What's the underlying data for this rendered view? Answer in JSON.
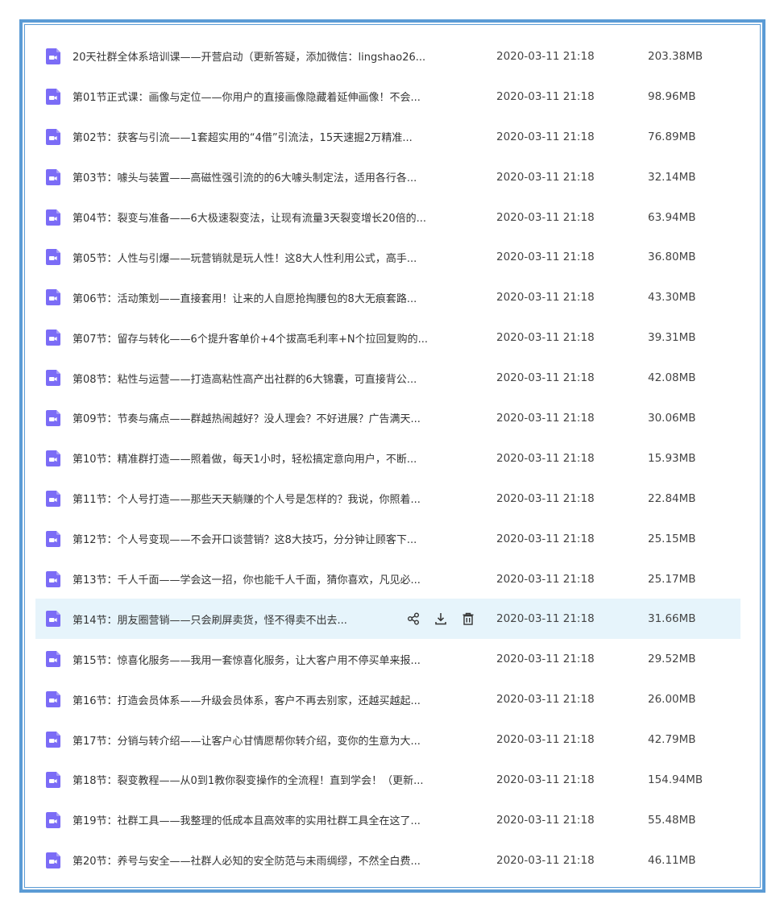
{
  "colors": {
    "accent": "#5b9bd5",
    "icon": "#7b6cf6",
    "hover_bg": "#e6f4fb"
  },
  "files": [
    {
      "name": "20天社群全体系培训课——开营启动（更新答疑，添加微信：lingshao26...",
      "date": "2020-03-11 21:18",
      "size": "203.38MB",
      "icon": "video-file-icon"
    },
    {
      "name": "第01节正式课：画像与定位——你用户的直接画像隐藏着延伸画像！不会...",
      "date": "2020-03-11 21:18",
      "size": "98.96MB",
      "icon": "video-file-icon"
    },
    {
      "name": "第02节：获客与引流——1套超实用的“4借”引流法，15天速掘2万精准...",
      "date": "2020-03-11 21:18",
      "size": "76.89MB",
      "icon": "video-file-icon"
    },
    {
      "name": "第03节：噱头与装置——高磁性强引流的的6大噱头制定法，适用各行各...",
      "date": "2020-03-11 21:18",
      "size": "32.14MB",
      "icon": "video-file-icon"
    },
    {
      "name": "第04节：裂变与准备——6大极速裂变法，让现有流量3天裂变增长20倍的...",
      "date": "2020-03-11 21:18",
      "size": "63.94MB",
      "icon": "video-file-icon"
    },
    {
      "name": "第05节：人性与引爆——玩营销就是玩人性！这8大人性利用公式，高手...",
      "date": "2020-03-11 21:18",
      "size": "36.80MB",
      "icon": "video-file-icon"
    },
    {
      "name": "第06节：活动策划——直接套用！让来的人自愿抢掏腰包的8大无痕套路...",
      "date": "2020-03-11 21:18",
      "size": "43.30MB",
      "icon": "video-file-icon"
    },
    {
      "name": "第07节：留存与转化——6个提升客单价+4个拔高毛利率+N个拉回复购的...",
      "date": "2020-03-11 21:18",
      "size": "39.31MB",
      "icon": "video-file-icon"
    },
    {
      "name": "第08节：粘性与运营——打造高粘性高产出社群的6大锦囊，可直接背公...",
      "date": "2020-03-11 21:18",
      "size": "42.08MB",
      "icon": "video-file-icon"
    },
    {
      "name": "第09节：节奏与痛点——群越热闹越好？没人理会？不好进展？广告满天...",
      "date": "2020-03-11 21:18",
      "size": "30.06MB",
      "icon": "video-file-icon"
    },
    {
      "name": "第10节：精准群打造——照着做，每天1小时，轻松搞定意向用户，不断...",
      "date": "2020-03-11 21:18",
      "size": "15.93MB",
      "icon": "video-file-icon"
    },
    {
      "name": "第11节：个人号打造——那些天天躺赚的个人号是怎样的？我说，你照着...",
      "date": "2020-03-11 21:18",
      "size": "22.84MB",
      "icon": "video-file-icon"
    },
    {
      "name": "第12节：个人号变现——不会开口谈营销？这8大技巧，分分钟让顾客下...",
      "date": "2020-03-11 21:18",
      "size": "25.15MB",
      "icon": "video-file-icon"
    },
    {
      "name": "第13节：千人千面——学会这一招，你也能千人千面，猜你喜欢，凡见必...",
      "date": "2020-03-11 21:18",
      "size": "25.17MB",
      "icon": "video-file-icon"
    },
    {
      "name": "第14节：朋友圈营销——只会刷屏卖货，怪不得卖不出去...",
      "date": "2020-03-11 21:18",
      "size": "31.66MB",
      "icon": "video-file-icon",
      "hover": true
    },
    {
      "name": "第15节：惊喜化服务——我用一套惊喜化服务，让大客户用不停买单来报...",
      "date": "2020-03-11 21:18",
      "size": "29.52MB",
      "icon": "video-file-icon"
    },
    {
      "name": "第16节：打造会员体系——升级会员体系，客户不再去别家，还越买越起...",
      "date": "2020-03-11 21:18",
      "size": "26.00MB",
      "icon": "video-file-icon"
    },
    {
      "name": "第17节：分销与转介绍——让客户心甘情愿帮你转介绍，变你的生意为大...",
      "date": "2020-03-11 21:18",
      "size": "42.79MB",
      "icon": "video-file-icon"
    },
    {
      "name": "第18节：裂变教程——从0到1教你裂变操作的全流程！直到学会！（更新...",
      "date": "2020-03-11 21:18",
      "size": "154.94MB",
      "icon": "video-file-icon"
    },
    {
      "name": "第19节：社群工具——我整理的低成本且高效率的实用社群工具全在这了...",
      "date": "2020-03-11 21:18",
      "size": "55.48MB",
      "icon": "video-file-icon"
    },
    {
      "name": "第20节：养号与安全——社群人必知的安全防范与未雨绸缪，不然全白费...",
      "date": "2020-03-11 21:18",
      "size": "46.11MB",
      "icon": "video-file-icon"
    }
  ],
  "row_actions": [
    "share-icon",
    "download-icon",
    "delete-icon"
  ]
}
